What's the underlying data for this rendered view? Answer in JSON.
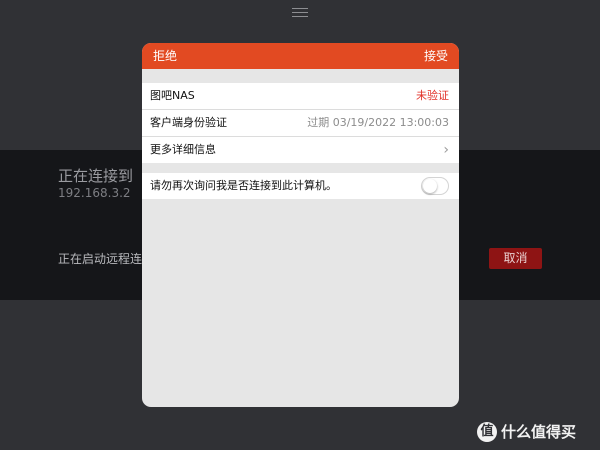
{
  "background": {
    "menu_icon": "hamburger-icon",
    "connection": {
      "title": "正在连接到",
      "ip": "192.168.3.2",
      "status": "正在启动远程连接",
      "cancel_label": "取消"
    }
  },
  "dialog": {
    "header": {
      "reject_label": "拒绝",
      "accept_label": "接受"
    },
    "rows": [
      {
        "label": "图吧NAS",
        "value": "未验证"
      },
      {
        "label": "客户端身份验证",
        "value": "过期 03/19/2022 13:00:03"
      },
      {
        "label": "更多详细信息",
        "value": "›"
      }
    ],
    "option": {
      "label": "请勿再次询问我是否连接到此计算机。",
      "toggle_state": "off"
    }
  },
  "watermark": {
    "logo_text": "值",
    "text": "什么值得买"
  },
  "colors": {
    "header": "#e24a22",
    "unverified": "#e23128",
    "cancel_button": "#8e1414"
  }
}
